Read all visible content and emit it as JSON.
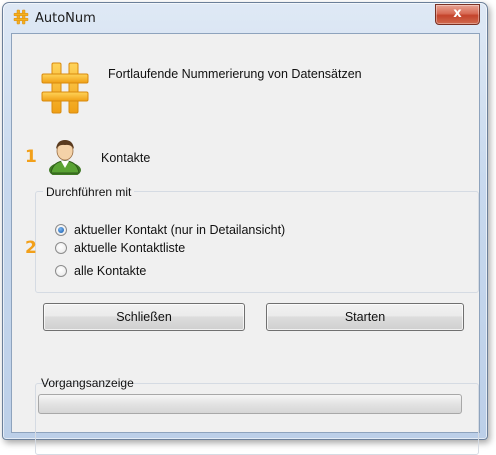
{
  "window": {
    "title": "AutoNum",
    "close_glyph": "x"
  },
  "header": {
    "description": "Fortlaufende Nummerierung von Datensätzen",
    "icon": "hash-icon"
  },
  "markers": [
    "1",
    "2"
  ],
  "contacts": {
    "label": "Kontakte",
    "icon": "contact-person-icon"
  },
  "perform_with": {
    "legend": "Durchführen mit",
    "options": [
      {
        "label": "aktueller Kontakt (nur in Detailansicht)",
        "checked": true
      },
      {
        "label": "aktuelle Kontaktliste",
        "checked": false
      },
      {
        "label": "alle Kontakte",
        "checked": false
      }
    ]
  },
  "buttons": {
    "close_label": "Schließen",
    "start_label": "Starten"
  },
  "progress": {
    "legend": "Vorgangsanzeige",
    "value": 0
  },
  "colors": {
    "accent_orange": "#f2a01a",
    "titlebar_close": "#c4432b"
  }
}
